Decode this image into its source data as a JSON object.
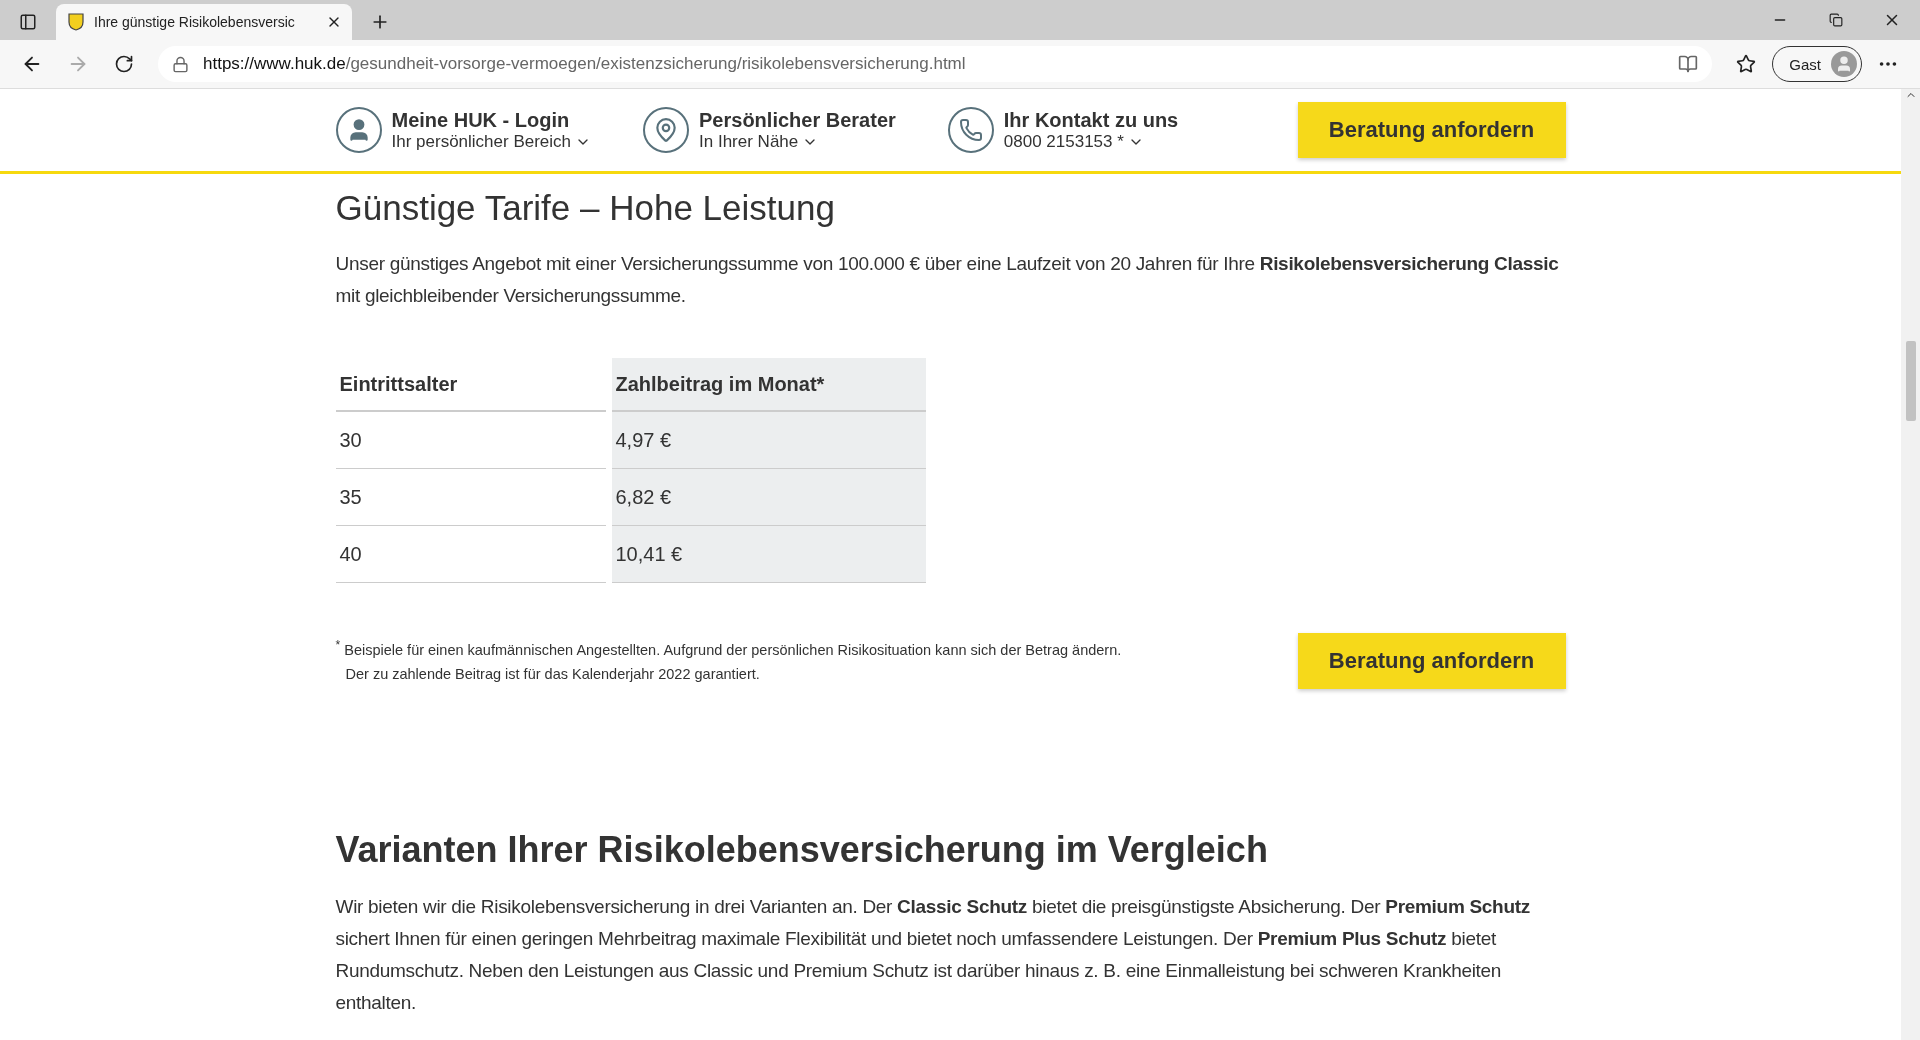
{
  "browser": {
    "tab_title": "Ihre günstige Risikolebensversic",
    "url_host": "https://www.huk.de",
    "url_path": "/gesundheit-vorsorge-vermoegen/existenzsicherung/risikolebensversicherung.html",
    "profile": "Gast"
  },
  "header": {
    "items": [
      {
        "kind": "person",
        "title": "Meine HUK - Login",
        "subtitle": "Ihr persönlicher Bereich"
      },
      {
        "kind": "pin",
        "title": "Persönlicher Berater",
        "subtitle": "In Ihrer Nähe"
      },
      {
        "kind": "phone",
        "title": "Ihr Kontakt zu uns",
        "subtitle": "0800 2153153 *"
      }
    ],
    "button": "Beratung anfordern"
  },
  "offer": {
    "heading": "Günstige Tarife – Hohe Leistung",
    "paragraph": "Unser günstiges Angebot mit einer Versicherungssumme von 100.000 € über eine Laufzeit von 20 Jahren für Ihre **Risikolebensversicherung Classic** mit gleichbleibender Versicherungssumme.",
    "table": {
      "columns": [
        "Eintrittsalter",
        "Zahlbeitrag im Monat*"
      ],
      "rows": [
        [
          "30",
          "4,97 €"
        ],
        [
          "35",
          "6,82 €"
        ],
        [
          "40",
          "10,41 €"
        ]
      ]
    },
    "footnote": [
      "$^{*}$ Beispiele für einen kaufmännischen Angestellten. Aufgrund der persönlichen Risikosituation kann sich der Betrag ändern.",
      "Der zu zahlende Beitrag ist für das Kalenderjahr 2022 garantiert."
    ],
    "button": "Beratung anfordern"
  },
  "variants": {
    "heading": "Varianten Ihrer Risikolebensversicherung im Vergleich",
    "paragraph": "Wir bieten wir die Risikolebensversicherung in drei Varianten an. Der **Classic Schutz** bietet die preisgünstigste Absicherung. Der **Premium Schutz** sichert Ihnen für einen geringen Mehrbeitrag maximale Flexibilität und bietet noch umfassendere Leistungen. Der **Premium Plus Schutz** bietet Rundumschutz. Neben den Leistungen aus Classic und Premium Schutz ist darüber hinaus z. B. eine Einmalleistung bei schweren Krankheiten enthalten."
  }
}
